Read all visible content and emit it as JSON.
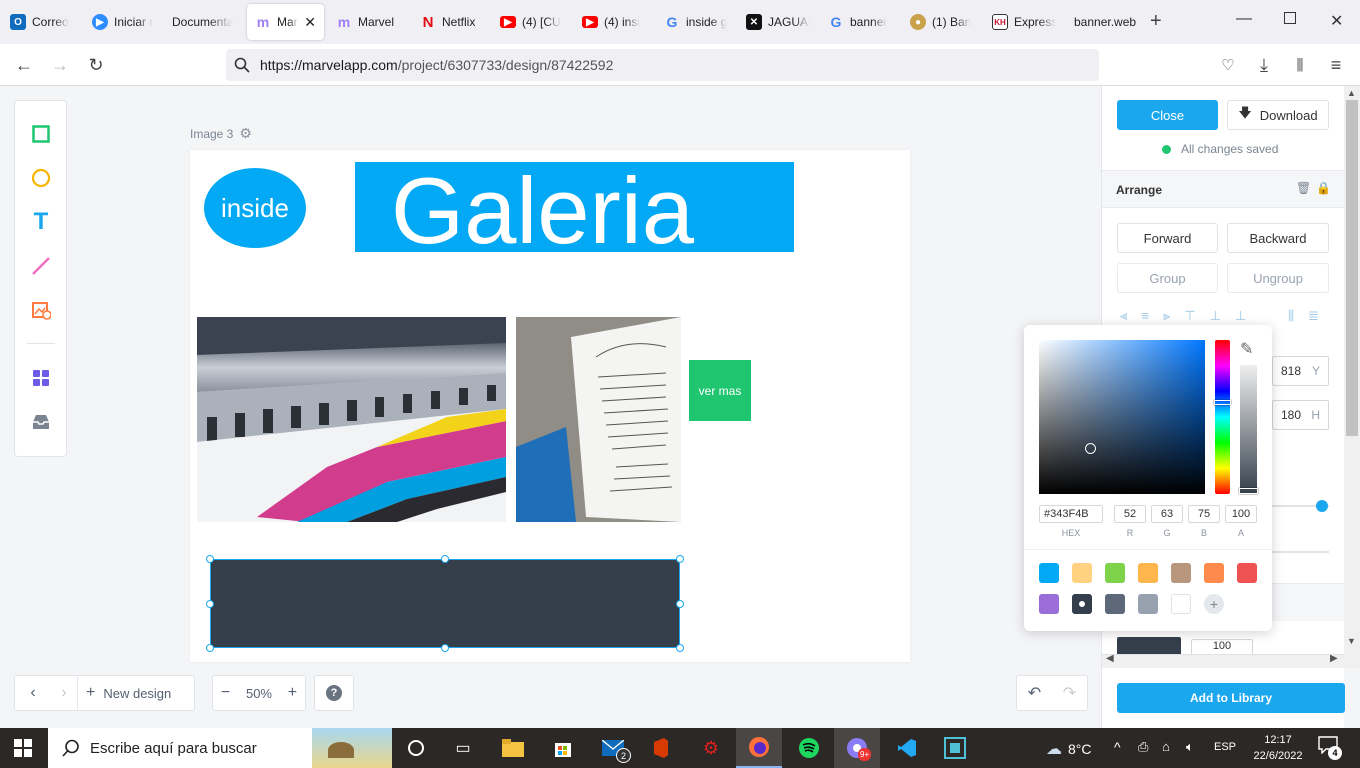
{
  "browser": {
    "tabs": [
      {
        "label": "Correo",
        "icon": "outlook-icon",
        "color": "#0f6cbd"
      },
      {
        "label": "Iniciar r",
        "icon": "zoom-icon",
        "color": "#2d8cff"
      },
      {
        "label": "Documenta",
        "icon": "",
        "color": ""
      },
      {
        "label": "Marvel",
        "icon": "marvel-icon",
        "color": "#9f7ff6",
        "active": true
      },
      {
        "label": "Marvel",
        "icon": "marvel-icon",
        "color": "#9f7ff6"
      },
      {
        "label": "Netflix",
        "icon": "netflix-icon",
        "color": "#e50914"
      },
      {
        "label": "(4) [CU",
        "icon": "youtube-icon",
        "color": "#ff0000"
      },
      {
        "label": "(4) insi",
        "icon": "youtube-icon",
        "color": "#ff0000"
      },
      {
        "label": "inside g",
        "icon": "google-icon",
        "color": "#4285f4"
      },
      {
        "label": "JAGUAI",
        "icon": "jaguar-icon",
        "color": "#111111"
      },
      {
        "label": "banner",
        "icon": "google-icon",
        "color": "#4285f4"
      },
      {
        "label": "(1) Ban",
        "icon": "banner-site-icon",
        "color": "#c8a24a"
      },
      {
        "label": "Express",
        "icon": "express-icon",
        "color": "#c8102e"
      },
      {
        "label": "banner.web",
        "icon": "",
        "color": ""
      }
    ],
    "new_tab": "+",
    "url_domain": "https://marvelapp.com",
    "url_path": "/project/6307733/design/87422592"
  },
  "canvas": {
    "label": "Image 3",
    "logo_text": "inside",
    "title_text": "Galeria",
    "button_text": "ver mas",
    "accent": "#03a9f4",
    "green": "#1fc66f",
    "rect_color": "#343f4b"
  },
  "bottom_toolbar": {
    "new_design": "New design",
    "zoom": "50%",
    "help": "?"
  },
  "panel": {
    "close": "Close",
    "download": "Download",
    "saved": "All changes saved",
    "arrange": "Arrange",
    "forward": "Forward",
    "backward": "Backward",
    "group": "Group",
    "ungroup": "Ungroup",
    "y_value": "818",
    "y_label": "Y",
    "h_value": "180",
    "h_label": "H",
    "opacity_value": "100",
    "add_library": "Add to Library"
  },
  "picker": {
    "hex": "#343F4B",
    "r": "52",
    "g": "63",
    "b": "75",
    "a": "100",
    "labels": {
      "hex": "HEX",
      "r": "R",
      "g": "G",
      "b": "B",
      "a": "A"
    },
    "swatches": [
      "#03a9f4",
      "#ffd282",
      "#7ed34b",
      "#ffb74d",
      "#b8977e",
      "#ff8a4c",
      "#ee5253",
      "#9b6dd8",
      "#343f4b",
      "#5d6978",
      "#98a2ae",
      "#ffffff"
    ],
    "selected_index": 8
  },
  "taskbar": {
    "search_placeholder": "Escribe aquí para buscar",
    "mail_badge": "2",
    "chrome_badge": "9+",
    "weather": "8°C",
    "lang": "ESP",
    "time": "12:17",
    "date": "22/6/2022",
    "notif": "4"
  }
}
